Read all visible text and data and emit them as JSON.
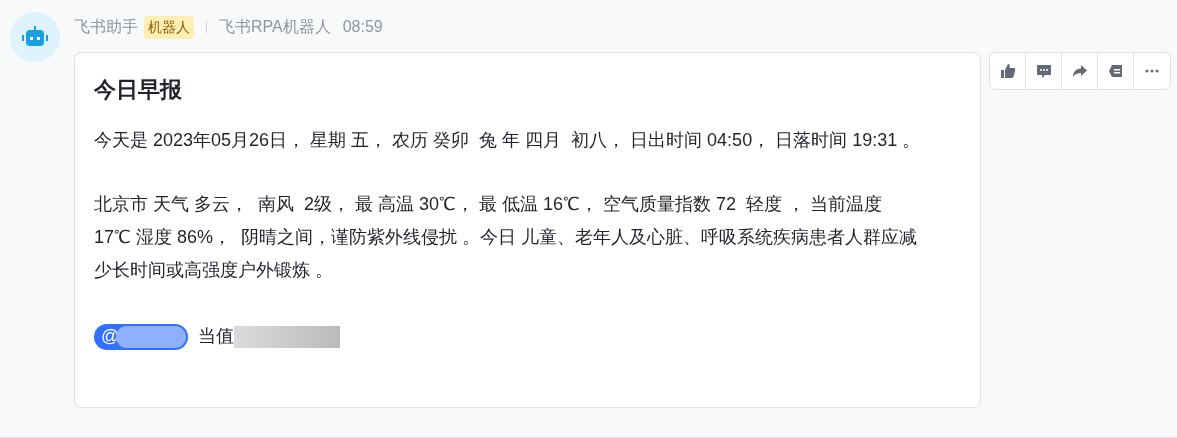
{
  "message": {
    "sender": "飞书助手",
    "badge": "机器人",
    "source": "飞书RPA机器人",
    "time": "08:59",
    "card": {
      "title": "今日早报",
      "paragraphs": [
        "今天是 2023年05月26日， 星期 五， 农历 癸卯  兔 年 四月  初八， 日出时间 04:50， 日落时间 19:31 。",
        "北京市 天气 多云，  南风  2级， 最 高温 30℃， 最 低温 16℃， 空气质量指数 72  轻度 ， 当前温度 17℃ 湿度 86%，  阴晴之间，谨防紫外线侵扰 。今日 儿童、老年人及心脏、呼吸系统疾病患者人群应减少长时间或高强度户外锻炼 。"
      ],
      "mention": "@",
      "duty_label": "当值"
    }
  },
  "actions": [
    {
      "kind": "like"
    },
    {
      "kind": "reply"
    },
    {
      "kind": "forward"
    },
    {
      "kind": "pin"
    },
    {
      "kind": "more"
    }
  ]
}
